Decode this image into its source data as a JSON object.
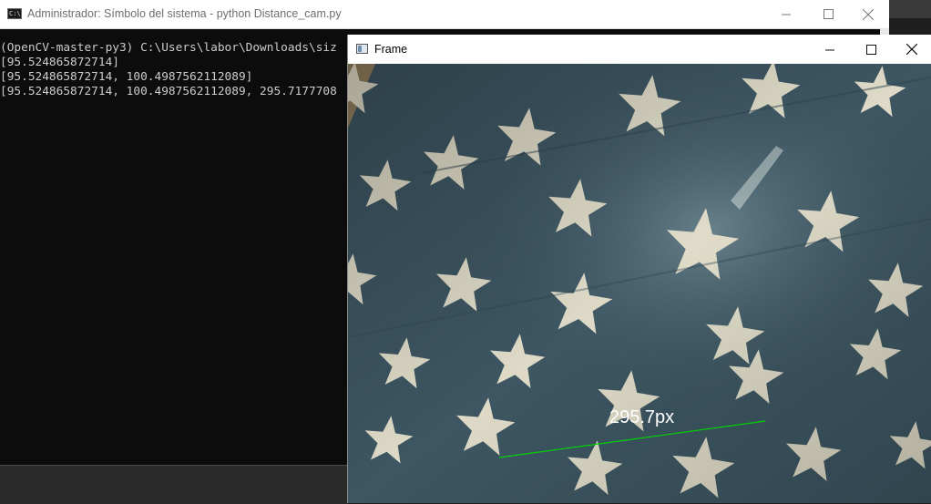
{
  "console": {
    "title": "Administrador: Símbolo del sistema - python  Distance_cam.py",
    "icon": "cmd-icon",
    "lines": [
      "(OpenCV-master-py3) C:\\Users\\labor\\Downloads\\siz",
      "[95.524865872714]",
      "[95.524865872714, 100.4987562112089]",
      "[95.524865872714, 100.4987562112089, 295.7177708"
    ],
    "status_text": "",
    "controls": {
      "minimize": "minimize-icon",
      "maximize": "maximize-icon",
      "close": "close-icon"
    }
  },
  "frame_window": {
    "title": "Frame",
    "measurement_label": "295.7px",
    "measurement_line_color": "#00d400",
    "controls": {
      "minimize": "minimize-icon",
      "maximize": "maximize-icon",
      "close": "close-icon"
    }
  },
  "colors": {
    "console_bg": "#0c0c0c",
    "console_text": "#cccccc",
    "flag_blue": "#3d5662",
    "star": "#e7e2cc"
  }
}
